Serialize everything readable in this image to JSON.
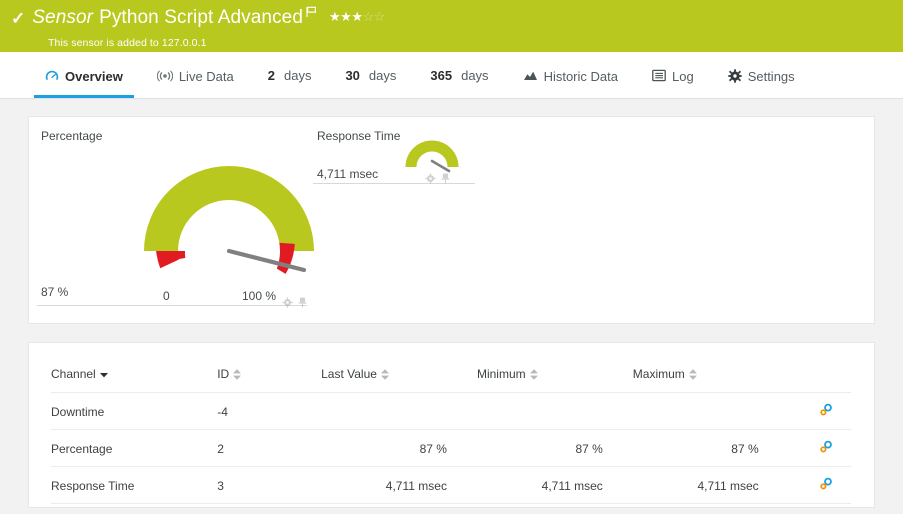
{
  "header": {
    "status_icon": "check-icon",
    "type_label": "Sensor",
    "title": "Python Script Advanced",
    "flag_icon": "flag-icon",
    "rating": 3,
    "rating_max": 5,
    "subtitle": "This sensor is added to 127.0.0.1",
    "bg_color": "#b9c81e"
  },
  "tabs": [
    {
      "label": "Overview",
      "icon": "gauge-icon",
      "active": true
    },
    {
      "label": "Live Data",
      "icon": "broadcast-icon",
      "active": false
    },
    {
      "num": "2",
      "unit": "days",
      "icon": null,
      "active": false
    },
    {
      "num": "30",
      "unit": "days",
      "icon": null,
      "active": false
    },
    {
      "num": "365",
      "unit": "days",
      "icon": null,
      "active": false
    },
    {
      "label": "Historic Data",
      "icon": "area-chart-icon",
      "active": false
    },
    {
      "label": "Log",
      "icon": "list-icon",
      "active": false
    },
    {
      "label": "Settings",
      "icon": "gear-icon",
      "active": false
    }
  ],
  "gauges": {
    "percentage": {
      "label": "Percentage",
      "value_text": "87 %",
      "min_label": "0",
      "max_label": "100 %",
      "value": 87,
      "min": 0,
      "max": 100,
      "ok_color": "#b9c81e",
      "alert_color": "#e01b22",
      "needle_color": "#808080"
    },
    "response_time": {
      "label": "Response Time",
      "value_text": "4,711 msec",
      "ok_color": "#b9c81e",
      "needle_color": "#808080"
    }
  },
  "table": {
    "columns": [
      {
        "key": "channel",
        "label": "Channel",
        "sort": "desc-active"
      },
      {
        "key": "id",
        "label": "ID",
        "sort": "both"
      },
      {
        "key": "last",
        "label": "Last Value",
        "sort": "both"
      },
      {
        "key": "min",
        "label": "Minimum",
        "sort": "both"
      },
      {
        "key": "max",
        "label": "Maximum",
        "sort": "both"
      },
      {
        "key": "actions",
        "label": "",
        "sort": null
      }
    ],
    "rows": [
      {
        "channel": "Downtime",
        "id": "-4",
        "last": "",
        "min": "",
        "max": "",
        "action_icon": "channel-settings-icon"
      },
      {
        "channel": "Percentage",
        "id": "2",
        "last": "87 %",
        "min": "87 %",
        "max": "87 %",
        "action_icon": "channel-settings-icon"
      },
      {
        "channel": "Response Time",
        "id": "3",
        "last": "4,711 msec",
        "min": "4,711 msec",
        "max": "4,711 msec",
        "action_icon": "channel-settings-icon"
      }
    ]
  },
  "colors": {
    "brand_green": "#b9c81e",
    "accent_blue": "#1ba0e2",
    "alert_red": "#e01b22",
    "page_bg": "#f2f2f2"
  }
}
